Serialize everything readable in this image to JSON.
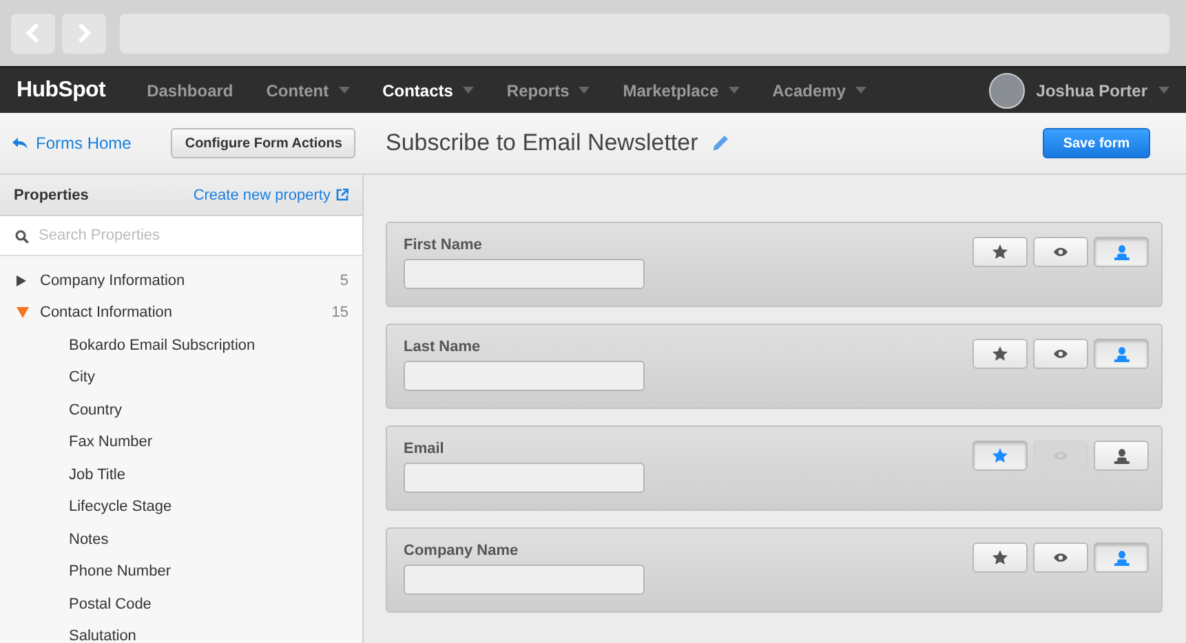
{
  "browser": {
    "back_disabled": true,
    "forward_disabled": true
  },
  "nav": {
    "logo": "HubSpot",
    "items": [
      {
        "label": "Dashboard",
        "selected": false,
        "has_menu": false
      },
      {
        "label": "Content",
        "selected": false,
        "has_menu": true
      },
      {
        "label": "Contacts",
        "selected": true,
        "has_menu": true
      },
      {
        "label": "Reports",
        "selected": false,
        "has_menu": true
      },
      {
        "label": "Marketplace",
        "selected": false,
        "has_menu": true
      },
      {
        "label": "Academy",
        "selected": false,
        "has_menu": true
      }
    ],
    "user": {
      "name": "Joshua Porter"
    }
  },
  "header": {
    "back_link": "Forms Home",
    "configure_button": "Configure Form Actions",
    "title": "Subscribe to Email Newsletter",
    "save_button": "Save form"
  },
  "sidebar": {
    "title": "Properties",
    "create_link": "Create new property",
    "search": {
      "placeholder": "Search Properties"
    },
    "groups": [
      {
        "label": "Company Information",
        "count": "5",
        "expanded": false
      },
      {
        "label": "Contact Information",
        "count": "15",
        "expanded": true,
        "children": [
          "Bokardo Email Subscription",
          "City",
          "Country",
          "Fax Number",
          "Job Title",
          "Lifecycle Stage",
          "Notes",
          "Phone Number",
          "Postal Code",
          "Salutation"
        ]
      }
    ]
  },
  "fields": [
    {
      "label": "First Name",
      "toggles": [
        {
          "kind": "required",
          "on": false,
          "disabled": false
        },
        {
          "kind": "hidden",
          "on": false,
          "disabled": false
        },
        {
          "kind": "smart",
          "on": true,
          "disabled": false
        }
      ]
    },
    {
      "label": "Last Name",
      "toggles": [
        {
          "kind": "required",
          "on": false,
          "disabled": false
        },
        {
          "kind": "hidden",
          "on": false,
          "disabled": false
        },
        {
          "kind": "smart",
          "on": true,
          "disabled": false
        }
      ]
    },
    {
      "label": "Email",
      "toggles": [
        {
          "kind": "required",
          "on": true,
          "disabled": false
        },
        {
          "kind": "hidden",
          "on": false,
          "disabled": true
        },
        {
          "kind": "smart",
          "on": false,
          "disabled": false
        }
      ]
    },
    {
      "label": "Company Name",
      "toggles": [
        {
          "kind": "required",
          "on": false,
          "disabled": false
        },
        {
          "kind": "hidden",
          "on": false,
          "disabled": false
        },
        {
          "kind": "smart",
          "on": true,
          "disabled": false
        }
      ]
    }
  ]
}
